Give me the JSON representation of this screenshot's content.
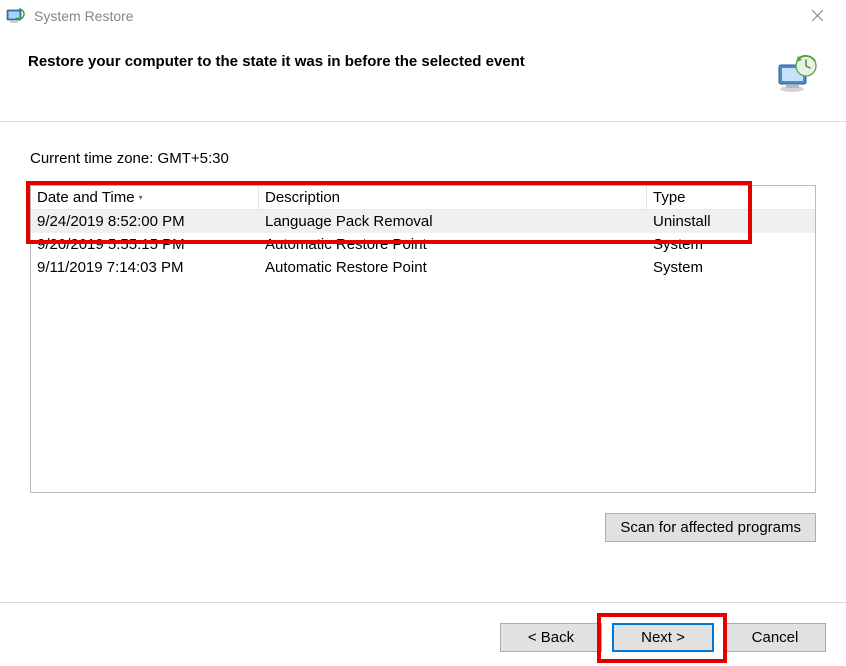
{
  "window": {
    "title": "System Restore"
  },
  "header": {
    "heading": "Restore your computer to the state it was in before the selected event"
  },
  "timezone": "Current time zone: GMT+5:30",
  "table": {
    "columns": {
      "date": "Date and Time",
      "desc": "Description",
      "type": "Type"
    },
    "sort_column": "date",
    "sort_direction": "desc",
    "rows": [
      {
        "date": "9/24/2019 8:52:00 PM",
        "desc": "Language Pack Removal",
        "type": "Uninstall",
        "selected": true
      },
      {
        "date": "9/20/2019 5:55:15 PM",
        "desc": "Automatic Restore Point",
        "type": "System",
        "selected": false
      },
      {
        "date": "9/11/2019 7:14:03 PM",
        "desc": "Automatic Restore Point",
        "type": "System",
        "selected": false
      }
    ]
  },
  "buttons": {
    "scan": "Scan for affected programs",
    "back": "< Back",
    "next": "Next >",
    "cancel": "Cancel"
  }
}
